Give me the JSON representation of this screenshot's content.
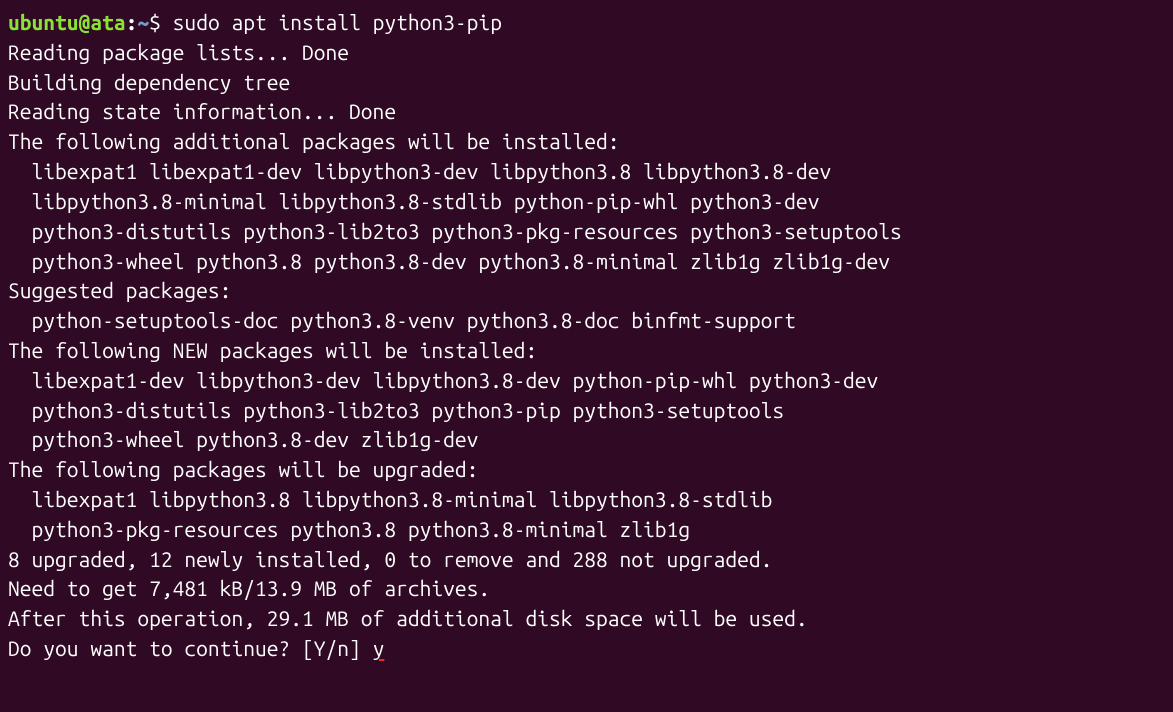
{
  "prompt": {
    "user": "ubuntu@ata",
    "sep": ":",
    "path": "~",
    "dollar": "$ "
  },
  "command": "sudo apt install python3-pip",
  "lines": {
    "l1": "Reading package lists... Done",
    "l2": "Building dependency tree",
    "l3": "Reading state information... Done",
    "l4": "The following additional packages will be installed:",
    "l5": "  libexpat1 libexpat1-dev libpython3-dev libpython3.8 libpython3.8-dev",
    "l6": "  libpython3.8-minimal libpython3.8-stdlib python-pip-whl python3-dev",
    "l7": "  python3-distutils python3-lib2to3 python3-pkg-resources python3-setuptools",
    "l8": "  python3-wheel python3.8 python3.8-dev python3.8-minimal zlib1g zlib1g-dev",
    "l9": "Suggested packages:",
    "l10": "  python-setuptools-doc python3.8-venv python3.8-doc binfmt-support",
    "l11": "The following NEW packages will be installed:",
    "l12": "  libexpat1-dev libpython3-dev libpython3.8-dev python-pip-whl python3-dev",
    "l13": "  python3-distutils python3-lib2to3 python3-pip python3-setuptools",
    "l14": "  python3-wheel python3.8-dev zlib1g-dev",
    "l15": "The following packages will be upgraded:",
    "l16": "  libexpat1 libpython3.8 libpython3.8-minimal libpython3.8-stdlib",
    "l17": "  python3-pkg-resources python3.8 python3.8-minimal zlib1g",
    "l18": "8 upgraded, 12 newly installed, 0 to remove and 288 not upgraded.",
    "l19": "Need to get 7,481 kB/13.9 MB of archives.",
    "l20": "After this operation, 29.1 MB of additional disk space will be used.",
    "l21": "Do you want to continue? [Y/n] "
  },
  "response": "y"
}
